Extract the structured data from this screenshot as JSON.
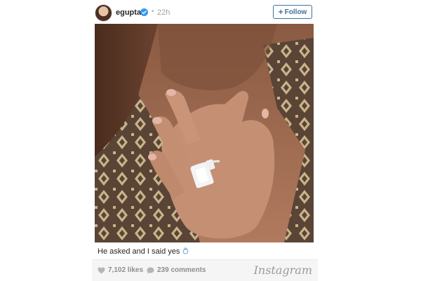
{
  "post": {
    "username": "egupta",
    "time_ago": "22h",
    "separator": "•",
    "follow_label": "Follow",
    "caption": "He asked and I said yes",
    "likes": "7,102 likes",
    "comments": "239 comments",
    "brand": "Instagram"
  },
  "colors": {
    "accent": "#3f729b",
    "verified": "#3897f0",
    "meta_text": "#8e8e8e"
  },
  "icons": {
    "verified": "verified-badge-icon",
    "heart": "heart-icon",
    "comment": "comment-bubble-icon",
    "ring": "ring-emoji-icon"
  }
}
